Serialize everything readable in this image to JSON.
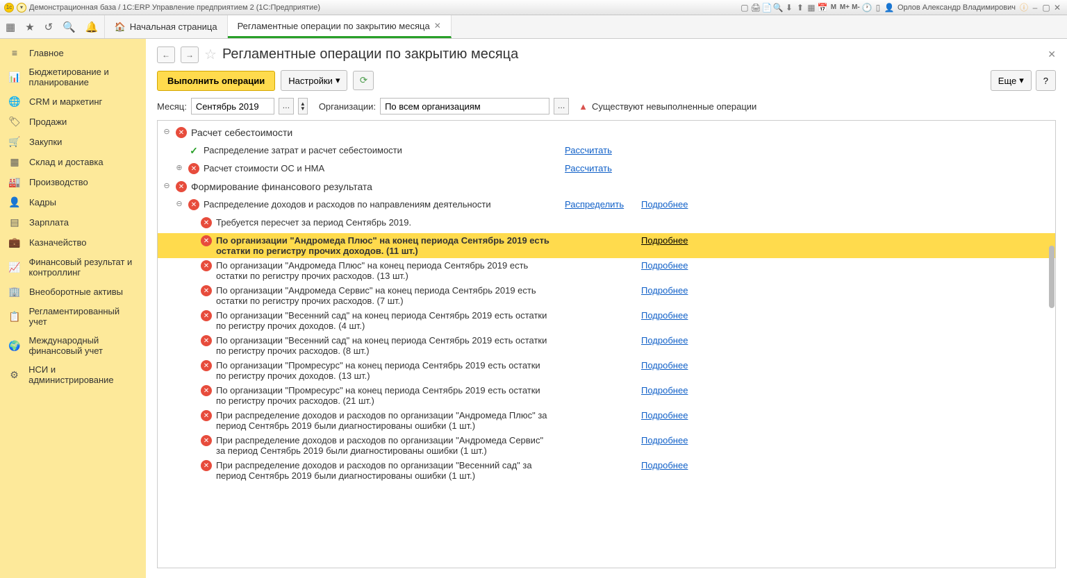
{
  "title_bar": {
    "app": "Демонстрационная база / 1С:ERP Управление предприятием 2  (1С:Предприятие)",
    "user": "Орлов Александр Владимирович"
  },
  "tabs": {
    "home": "Начальная страница",
    "t1": "Регламентные операции по закрытию месяца"
  },
  "sidebar": [
    {
      "icon": "≡",
      "label": "Главное"
    },
    {
      "icon": "📊",
      "label": "Бюджетирование и планирование"
    },
    {
      "icon": "🌐",
      "label": "CRM и маркетинг"
    },
    {
      "icon": "🏷",
      "label": "Продажи"
    },
    {
      "icon": "🛒",
      "label": "Закупки"
    },
    {
      "icon": "▦",
      "label": "Склад и доставка"
    },
    {
      "icon": "🏭",
      "label": "Производство"
    },
    {
      "icon": "👤",
      "label": "Кадры"
    },
    {
      "icon": "▤",
      "label": "Зарплата"
    },
    {
      "icon": "💼",
      "label": "Казначейство"
    },
    {
      "icon": "📈",
      "label": "Финансовый результат и контроллинг"
    },
    {
      "icon": "🏢",
      "label": "Внеоборотные активы"
    },
    {
      "icon": "📋",
      "label": "Регламентированный учет"
    },
    {
      "icon": "🌍",
      "label": "Международный финансовый учет"
    },
    {
      "icon": "⚙",
      "label": "НСИ и администрирование"
    }
  ],
  "page": {
    "title": "Регламентные операции по закрытию месяца"
  },
  "buttons": {
    "run": "Выполнить операции",
    "settings": "Настройки",
    "more": "Еще",
    "help": "?"
  },
  "filter": {
    "month_lbl": "Месяц:",
    "month": "Сентябрь 2019",
    "org_lbl": "Организации:",
    "org": "По всем организациям",
    "warn": "Существуют невыполненные операции"
  },
  "links": {
    "calc": "Рассчитать",
    "dist": "Распределить",
    "more": "Подробнее"
  },
  "tree": {
    "g1": "Расчет себестоимости",
    "g1r1": "Распределение затрат и расчет себестоимости",
    "g1r2": "Расчет стоимости ОС и НМА",
    "g2": "Формирование финансового результата",
    "g2r1": "Распределение доходов и расходов по направлениям деятельности",
    "e1": "Требуется пересчет за период Сентябрь 2019.",
    "e2": "По организации \"Андромеда Плюс\" на конец периода Сентябрь 2019 есть остатки по регистру прочих доходов. (11 шт.)",
    "e3": "По организации \"Андромеда Плюс\" на конец периода Сентябрь 2019 есть остатки по регистру прочих расходов. (13 шт.)",
    "e4": "По организации \"Андромеда Сервис\" на конец периода Сентябрь 2019 есть остатки по регистру прочих расходов. (7 шт.)",
    "e5": "По организации \"Весенний сад\" на конец периода Сентябрь 2019 есть остатки по регистру прочих доходов. (4 шт.)",
    "e6": "По организации \"Весенний сад\" на конец периода Сентябрь 2019 есть остатки по регистру прочих расходов. (8 шт.)",
    "e7": "По организации \"Промресурс\" на конец периода Сентябрь 2019 есть остатки по регистру прочих доходов. (13 шт.)",
    "e8": "По организации \"Промресурс\" на конец периода Сентябрь 2019 есть остатки по регистру прочих расходов. (21 шт.)",
    "e9": "При распределение доходов и расходов по организации \"Андромеда Плюс\" за период Сентябрь 2019 были диагностированы ошибки (1 шт.)",
    "e10": "При распределение доходов и расходов по организации \"Андромеда Сервис\" за период Сентябрь 2019 были диагностированы ошибки (1 шт.)",
    "e11": "При распределение доходов и расходов по организации \"Весенний сад\" за период Сентябрь 2019 были диагностированы ошибки (1 шт.)"
  }
}
